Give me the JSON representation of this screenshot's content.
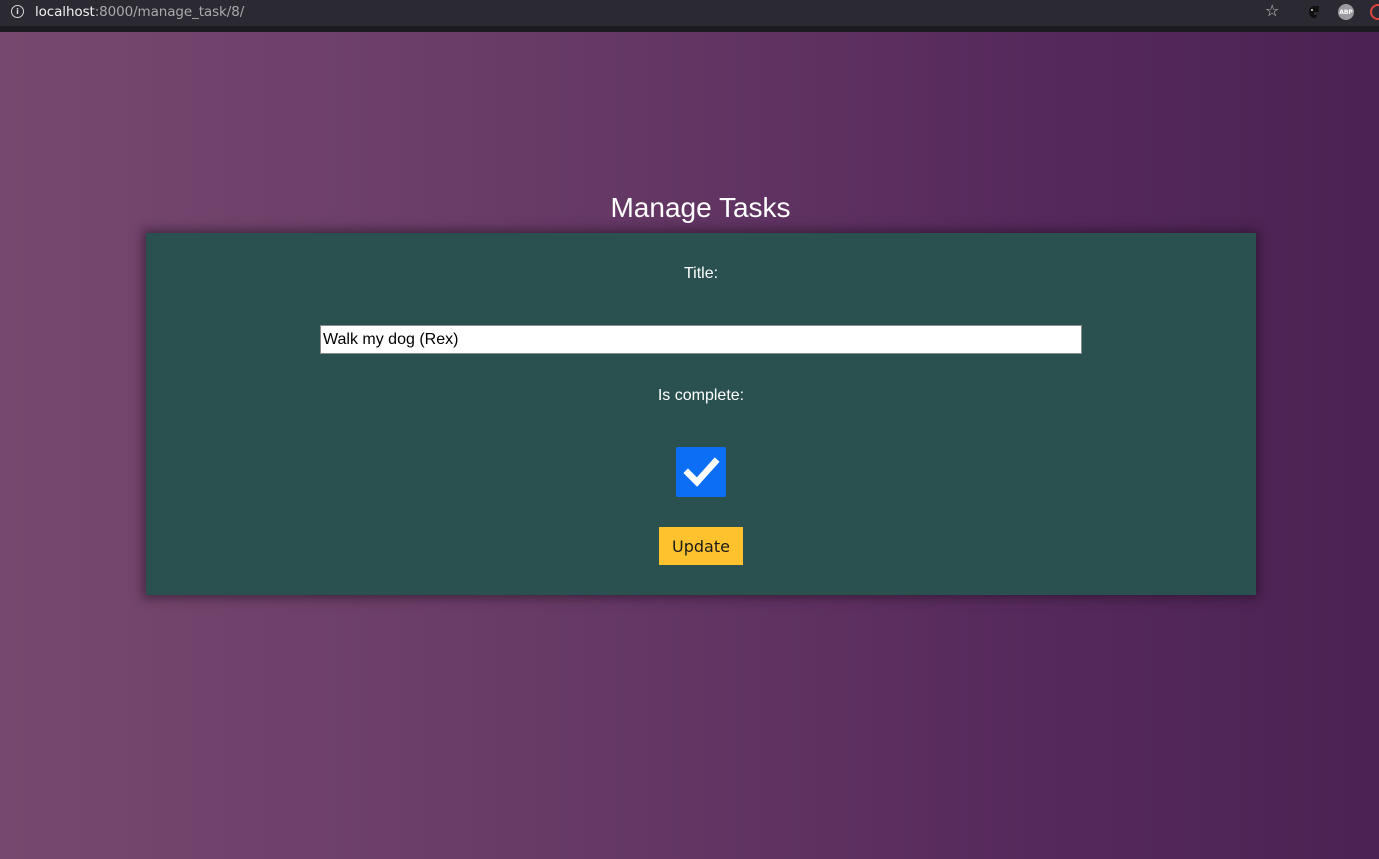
{
  "browser": {
    "url_host": "localhost",
    "url_rest": ":8000/manage_task/8/",
    "icons": [
      "info-icon",
      "star-icon",
      "extension-icon",
      "adblock-icon",
      "extension-icon"
    ],
    "abp_label": "ABP"
  },
  "page": {
    "title": "Manage Tasks",
    "form": {
      "title_label": "Title:",
      "title_value": "Walk my dog (Rex)",
      "complete_label": "Is complete:",
      "is_complete": true,
      "update_label": "Update"
    }
  },
  "colors": {
    "card_background": "#2b5050",
    "button_background": "#ffc22f",
    "checkbox_checked": "#0b6ef5"
  }
}
